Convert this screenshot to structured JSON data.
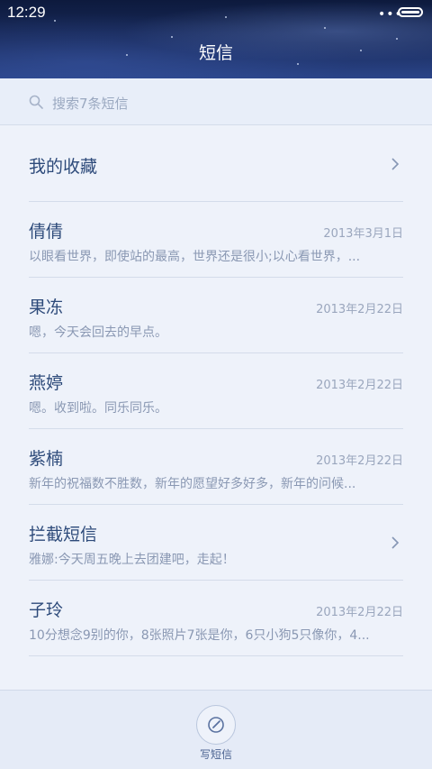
{
  "status_bar": {
    "time": "12:29",
    "signal": "•••",
    "battery_icon": "battery-icon"
  },
  "header": {
    "title": "短信"
  },
  "search": {
    "icon": "search-icon",
    "placeholder": "搜索7条短信"
  },
  "favorites": {
    "label": "我的收藏",
    "icon": "chevron-right-icon"
  },
  "messages": [
    {
      "name": "倩倩",
      "date": "2013年3月1日",
      "preview": "以眼看世界，即使站的最高，世界还是很小;以心看世界，..."
    },
    {
      "name": "果冻",
      "date": "2013年2月22日",
      "preview": "嗯，今天会回去的早点。"
    },
    {
      "name": "燕婷",
      "date": "2013年2月22日",
      "preview": "嗯。收到啦。同乐同乐。"
    },
    {
      "name": "紫楠",
      "date": "2013年2月22日",
      "preview": "新年的祝福数不胜数，新年的愿望好多好多，新年的问候..."
    },
    {
      "name": "拦截短信",
      "date": "",
      "preview": "雅娜:今天周五晚上去团建吧，走起！",
      "icon": "chevron-right-icon"
    },
    {
      "name": "子玲",
      "date": "2013年2月22日",
      "preview": "10分想念9别的你，8张照片7张是你，6只小狗5只像你，4..."
    }
  ],
  "bottom_bar": {
    "compose_label": "写短信",
    "compose_icon": "compose-icon"
  },
  "colors": {
    "accent": "#2d4a7a",
    "secondary_text": "#8a98b3",
    "background": "#eef2fa"
  }
}
